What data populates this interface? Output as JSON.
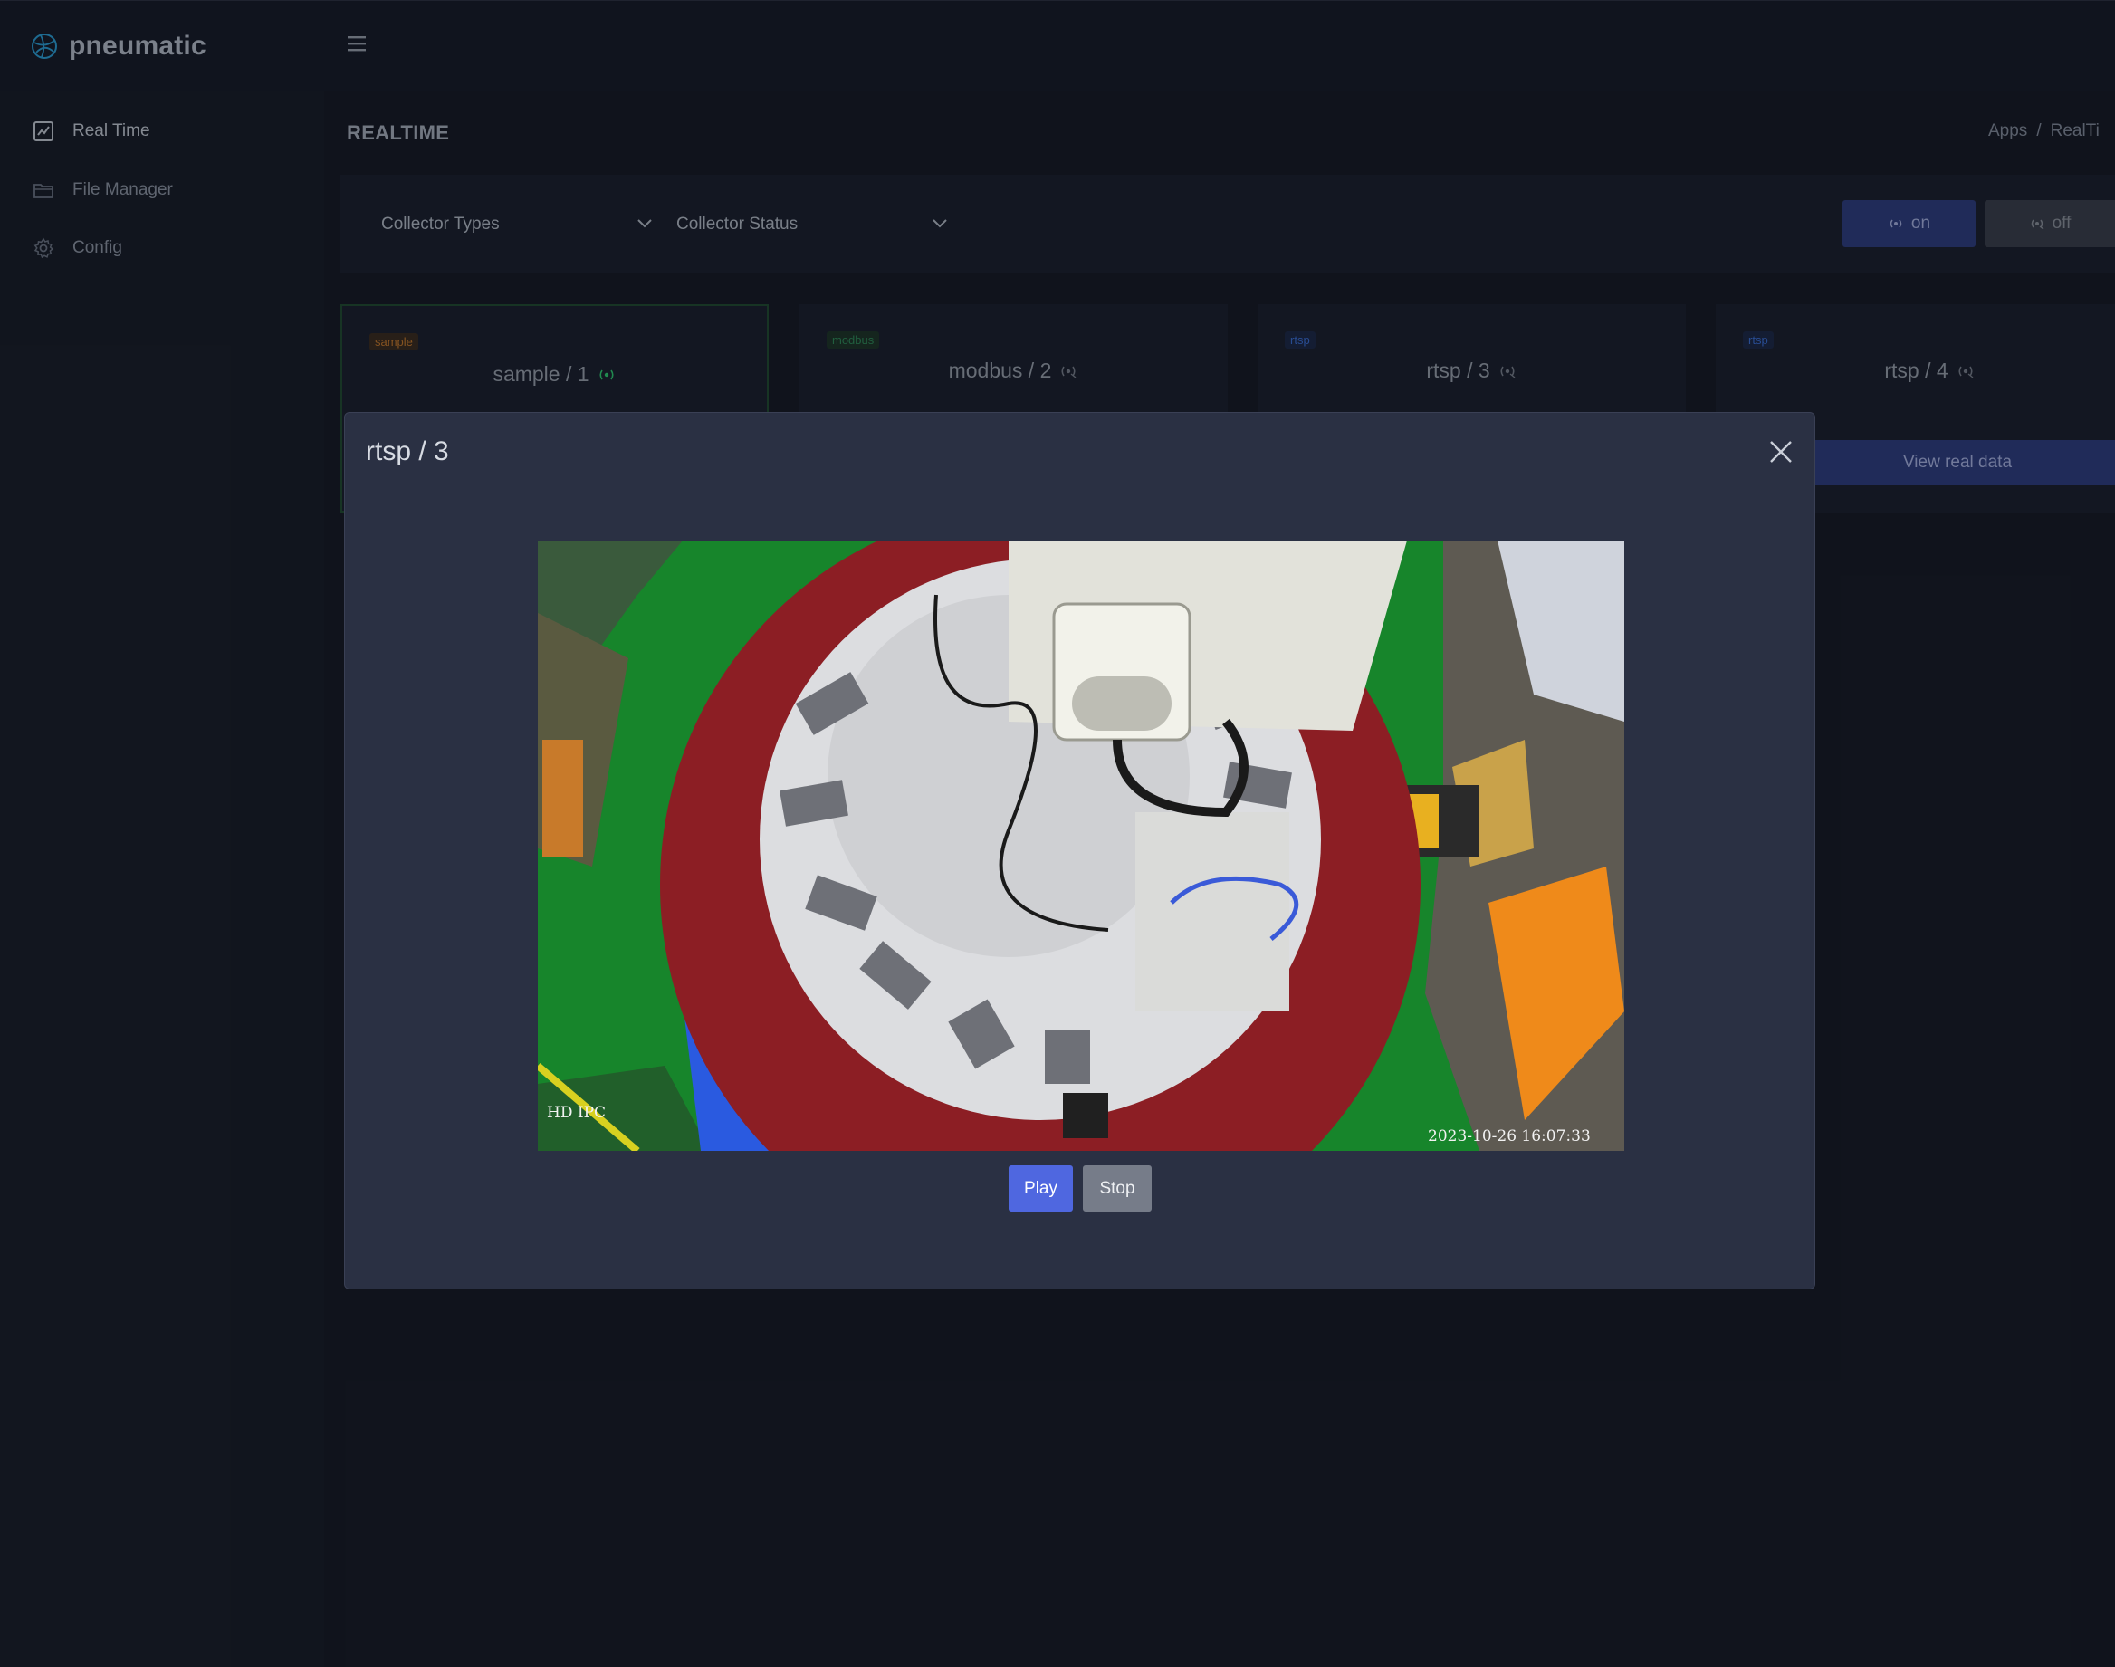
{
  "app": {
    "name": "pneumatic"
  },
  "sidebar": {
    "items": [
      {
        "label": "Real Time",
        "icon": "chart-icon",
        "active": true
      },
      {
        "label": "File Manager",
        "icon": "folder-icon",
        "active": false
      },
      {
        "label": "Config",
        "icon": "gear-icon",
        "active": false
      }
    ]
  },
  "page": {
    "title": "REALTIME",
    "breadcrumb": [
      "Apps",
      "RealTi"
    ]
  },
  "filters": {
    "collector_types": "Collector Types",
    "collector_status": "Collector Status",
    "on_label": "on",
    "off_label": "off"
  },
  "cards": [
    {
      "badge": "sample",
      "title": "sample / 1",
      "status_icon": "broadcast-on-icon",
      "badge_color": "#c87a2a"
    },
    {
      "badge": "modbus",
      "title": "modbus / 2",
      "status_icon": "broadcast-off-icon",
      "badge_color": "#2e8b57"
    },
    {
      "badge": "rtsp",
      "title": "rtsp / 3",
      "status_icon": "broadcast-off-icon",
      "badge_color": "#3a6fd8"
    },
    {
      "badge": "rtsp",
      "title": "rtsp / 4",
      "status_icon": "broadcast-off-icon",
      "badge_color": "#3a6fd8"
    }
  ],
  "view_real_data": "View real data",
  "modal": {
    "title": "rtsp / 3",
    "video": {
      "label": "HD IPC",
      "timestamp": "2023-10-26 16:07:33"
    },
    "play_label": "Play",
    "stop_label": "Stop"
  },
  "colors": {
    "accent": "#4f67e0",
    "on_active": "#2ecc71"
  }
}
